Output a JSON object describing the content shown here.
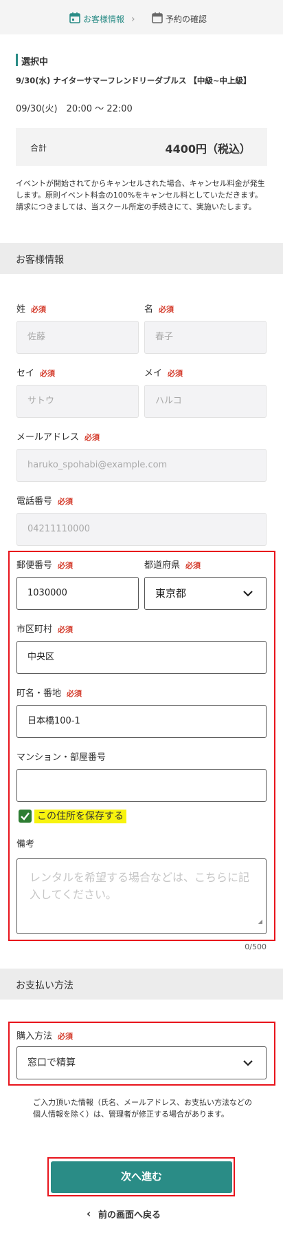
{
  "steps": {
    "step1": "お客様情報",
    "step2": "予約の確認",
    "step1_icon": "calendar-icon",
    "step2_icon": "calendar-icon",
    "separator_icon": "chevron-right-icon"
  },
  "selection": {
    "title": "選択中",
    "event_name": "9/30(水) ナイターサマーフレンドリーダブルス 【中級~中上級】",
    "event_datetime": "09/30(火)　20:00 〜 22:00",
    "total_label": "合計",
    "total_value": "4400円（税込）",
    "cancel_note": "イベントが開始されてからキャンセルされた場合、キャンセル料金が発生します。原則イベント料金の100%をキャンセル料としていただきます。請求につきましては、当スクール所定の手続きにて、実施いたします。"
  },
  "customer": {
    "section_title": "お客様情報",
    "required": "必須",
    "last_name_label": "姓",
    "last_name_value": "佐藤",
    "first_name_label": "名",
    "first_name_value": "春子",
    "last_kana_label": "セイ",
    "last_kana_value": "サトウ",
    "first_kana_label": "メイ",
    "first_kana_value": "ハルコ",
    "email_label": "メールアドレス",
    "email_value": "haruko_spohabi@example.com",
    "phone_label": "電話番号",
    "phone_value": "04211110000",
    "postal_label": "郵便番号",
    "postal_value": "1030000",
    "prefecture_label": "都道府県",
    "prefecture_value": "東京都",
    "city_label": "市区町村",
    "city_value": "中央区",
    "street_label": "町名・番地",
    "street_value": "日本橋100-1",
    "building_label": "マンション・部屋番号",
    "building_value": "",
    "save_address_label": "この住所を保存する",
    "save_address_checked": true,
    "notes_label": "備考",
    "notes_placeholder": "レンタルを希望する場合などは、こちらに記入してください。",
    "notes_counter": "0/500"
  },
  "payment": {
    "section_title": "お支払い方法",
    "method_label": "購入方法",
    "method_value": "窓口で精算",
    "privacy_note": "ご入力頂いた情報（氏名、メールアドレス、お支払い方法などの個人情報を除く）は、管理者が修正する場合があります。"
  },
  "actions": {
    "next_button": "次へ進む",
    "back_link": "前の画面へ戻る"
  },
  "colors": {
    "accent": "#2a8c86",
    "required": "#d43a2a",
    "highlight_box": "#e8131b",
    "checkbox": "#2e7d32",
    "label_highlight": "#f7f30e"
  }
}
